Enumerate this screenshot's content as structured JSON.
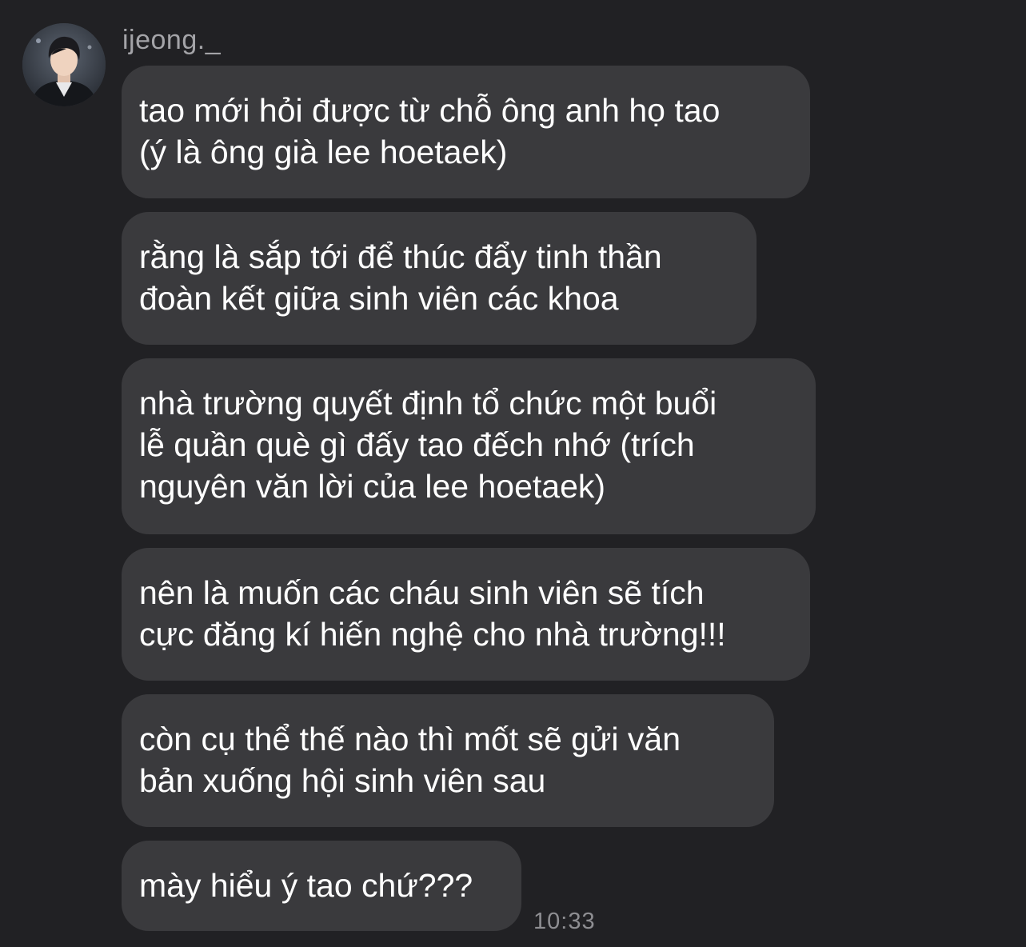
{
  "chat": {
    "sender": "ijeong._",
    "avatar_icon": "user-avatar-photo",
    "messages": [
      "tao mới hỏi được từ chỗ ông anh họ tao\n(ý là ông già lee hoetaek)",
      "rằng là sắp tới để thúc đẩy tinh thần\nđoàn kết giữa sinh viên các khoa",
      "nhà trường quyết định tổ chức một buổi\nlễ quần què gì đấy tao đếch nhớ (trích\nnguyên văn lời của lee hoetaek)",
      "nên là muốn các cháu sinh viên sẽ tích\ncực đăng kí hiến nghệ cho nhà trường!!!",
      "còn cụ thể thế nào thì mốt sẽ gửi văn\nbản xuống hội sinh viên sau",
      "mày hiểu ý tao chứ???"
    ],
    "timestamp": "10:33"
  },
  "colors": {
    "background": "#212124",
    "bubble": "#3a3a3d",
    "message_text": "#ffffff",
    "sender_text": "#a4a4a8",
    "timestamp_text": "#8e8e92"
  }
}
